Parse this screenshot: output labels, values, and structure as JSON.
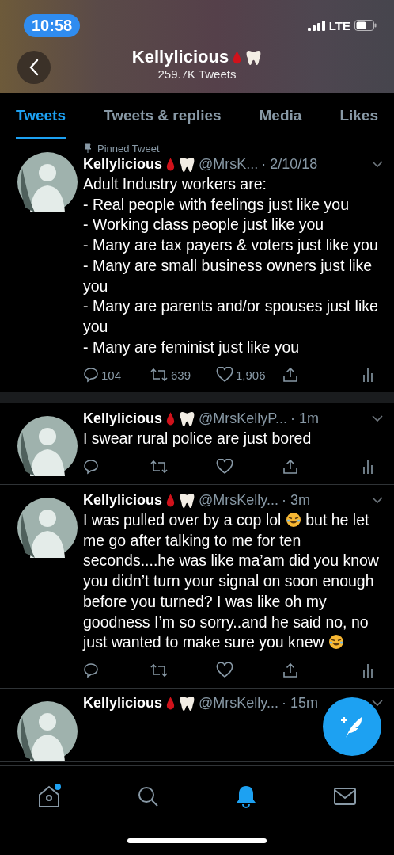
{
  "status_bar": {
    "time": "10:58",
    "network": "LTE"
  },
  "header": {
    "title": "Kellylicious",
    "subtitle": "259.7K Tweets"
  },
  "tabs": [
    {
      "label": "Tweets",
      "selected": true
    },
    {
      "label": "Tweets & replies",
      "selected": false
    },
    {
      "label": "Media",
      "selected": false
    },
    {
      "label": "Likes",
      "selected": false
    }
  ],
  "tweets": [
    {
      "pinned_label": "Pinned Tweet",
      "name": "Kellylicious",
      "handle": "@MrsK...",
      "time": "· 2/10/18",
      "lines": [
        [
          {
            "text": "Adult Industry workers are:"
          }
        ],
        [
          {
            "text": "- Real people with feelings just like you"
          }
        ],
        [
          {
            "text": "- Working class people just like you"
          }
        ],
        [
          {
            "text": "- Many are tax payers & voters just like you"
          }
        ],
        [
          {
            "text": "- Many are small business owners just like you"
          }
        ],
        [
          {
            "text": "- Many are parents and/or spouses just like you"
          }
        ],
        [
          {
            "text": "- Many are feminist just like you"
          }
        ]
      ],
      "replies": "104",
      "retweets": "639",
      "likes": "1,906",
      "gap_after": true
    },
    {
      "name": "Kellylicious",
      "handle": "@MrsKellyP...",
      "time": "· 1m",
      "lines": [
        [
          {
            "text": "I swear rural police are just bored"
          }
        ]
      ],
      "gap_after": false
    },
    {
      "name": "Kellylicious",
      "handle": "@MrsKelly...",
      "time": "· 3m",
      "lines": [
        [
          {
            "text": "I was pulled over by a cop lol "
          },
          {
            "kind": "emoji"
          },
          {
            "text": " but he let me go after talking to me for ten seconds....he was like ma’am did you know you didn’t turn your signal on soon enough before you turned? I was like oh my goodness I’m so sorry..and he said no, no just wanted to make sure you knew "
          },
          {
            "kind": "emoji"
          }
        ]
      ],
      "gap_after": false
    },
    {
      "name": "Kellylicious",
      "handle": "@MrsKelly...",
      "time": "· 15m",
      "gap_after": false
    }
  ],
  "nav": [
    {
      "kind": "home",
      "selected": false,
      "dot": true
    },
    {
      "kind": "search",
      "selected": false,
      "dot": false
    },
    {
      "kind": "bell",
      "selected": true,
      "dot": false
    },
    {
      "kind": "mail",
      "selected": false,
      "dot": false
    }
  ]
}
